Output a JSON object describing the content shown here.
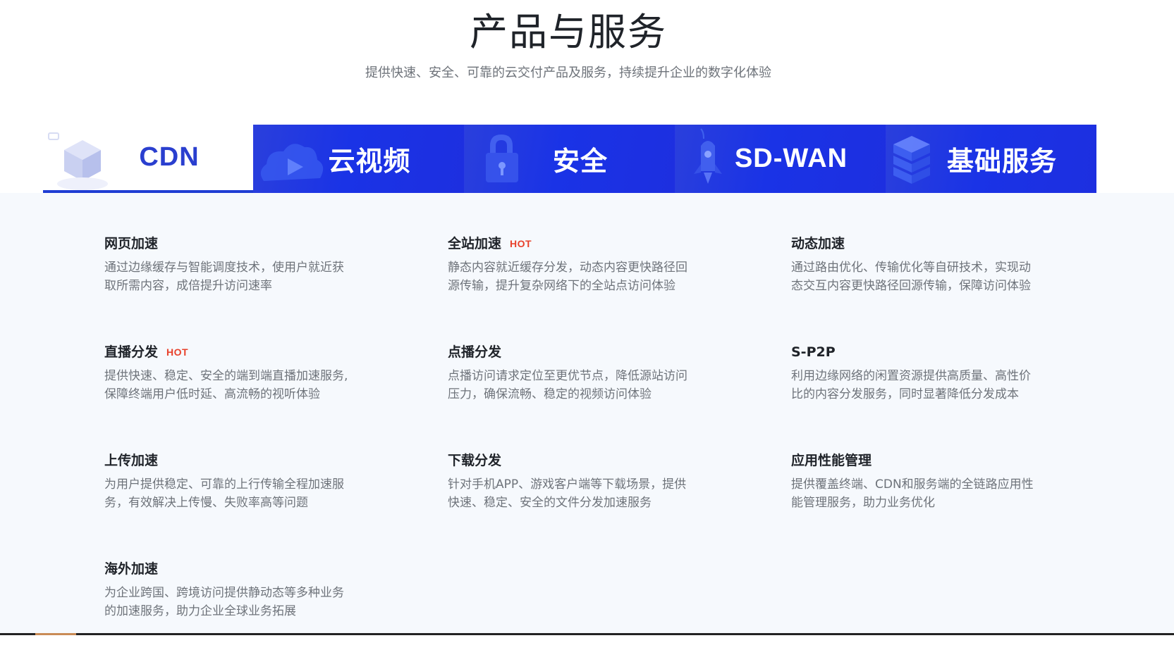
{
  "header": {
    "title": "产品与服务",
    "subtitle": "提供快速、安全、可靠的云交付产品及服务，持续提升企业的数字化体验"
  },
  "tabs": [
    {
      "label": "CDN",
      "icon": "cube-icon",
      "active": true
    },
    {
      "label": "云视频",
      "icon": "cloud-play-icon",
      "active": false
    },
    {
      "label": "安全",
      "icon": "lock-icon",
      "active": false
    },
    {
      "label": "SD-WAN",
      "icon": "rocket-icon",
      "active": false
    },
    {
      "label": "基础服务",
      "icon": "server-icon",
      "active": false
    }
  ],
  "products": [
    {
      "title": "网页加速",
      "hot": "",
      "desc": "通过边缘缓存与智能调度技术，使用户就近获取所需内容，成倍提升访问速率"
    },
    {
      "title": "全站加速",
      "hot": "HOT",
      "desc": "静态内容就近缓存分发，动态内容更快路径回源传输，提升复杂网络下的全站点访问体验"
    },
    {
      "title": "动态加速",
      "hot": "",
      "desc": "通过路由优化、传输优化等自研技术，实现动态交互内容更快路径回源传输，保障访问体验"
    },
    {
      "title": "直播分发",
      "hot": "HOT",
      "desc": "提供快速、稳定、安全的端到端直播加速服务, 保障终端用户低时延、高流畅的视听体验"
    },
    {
      "title": "点播分发",
      "hot": "",
      "desc": "点播访问请求定位至更优节点，降低源站访问压力，确保流畅、稳定的视频访问体验"
    },
    {
      "title": "S-P2P",
      "hot": "",
      "desc": "利用边缘网络的闲置资源提供高质量、高性价比的内容分发服务，同时显著降低分发成本"
    },
    {
      "title": "上传加速",
      "hot": "",
      "desc": "为用户提供稳定、可靠的上行传输全程加速服务，有效解决上传慢、失败率高等问题"
    },
    {
      "title": "下载分发",
      "hot": "",
      "desc": "针对手机APP、游戏客户端等下载场景，提供快速、稳定、安全的文件分发加速服务"
    },
    {
      "title": "应用性能管理",
      "hot": "",
      "desc": "提供覆盖终端、CDN和服务端的全链路应用性能管理服务，助力业务优化"
    },
    {
      "title": "海外加速",
      "hot": "",
      "desc": "为企业跨国、跨境访问提供静动态等多种业务的加速服务，助力企业全球业务拓展"
    }
  ],
  "colors": {
    "accent": "#1f3dd3",
    "hot": "#e8412b",
    "panel_bg": "#f6f9fd",
    "tab_bg": "#1a33e6"
  }
}
